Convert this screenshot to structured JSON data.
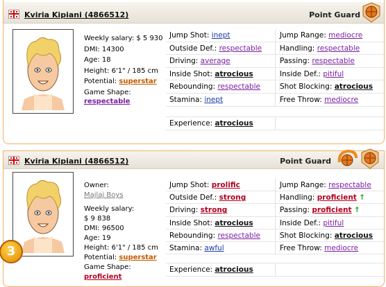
{
  "cards": [
    {
      "name": "Kviria Kipiani (4866512)",
      "position": "Point Guard",
      "info": {
        "salary": "Weekly salary: $ 5 930",
        "dmi": "DMI: 14300",
        "age": "Age: 18",
        "height": "Height: 6'1\" / 185 cm",
        "potential_label": "Potential:",
        "potential_value": "superstar",
        "shape_label": "Game Shape:",
        "shape_value": "respectable"
      },
      "skills": [
        {
          "label": "Jump Shot:",
          "value": "inept",
          "label2": "Jump Range:",
          "value2": "mediocre"
        },
        {
          "label": "Outside Def.:",
          "value": "respectable",
          "label2": "Handling:",
          "value2": "respectable"
        },
        {
          "label": "Driving:",
          "value": "average",
          "label2": "Passing:",
          "value2": "respectable"
        },
        {
          "label": "Inside Shot:",
          "value": "atrocious",
          "label2": "Inside Def.:",
          "value2": "pitiful"
        },
        {
          "label": "Rebounding:",
          "value": "respectable",
          "label2": "Shot Blocking:",
          "value2": "atrocious"
        },
        {
          "label": "Stamina:",
          "value": "inept",
          "label2": "Free Throw:",
          "value2": "mediocre"
        }
      ],
      "experience_label": "Experience:",
      "experience_value": "atrocious"
    },
    {
      "name": "Kviria Kipiani (4866512)",
      "position": "Point Guard",
      "info": {
        "owner_label": "Owner:",
        "owner_value": "Majlaj Boys",
        "salary_label": "Weekly salary:",
        "salary_value": "$ 9 838",
        "dmi": "DMI: 96500",
        "age": "Age: 19",
        "height": "Height: 6'1\" / 185 cm",
        "potential_label": "Potential:",
        "potential_value": "superstar",
        "shape_label": "Game Shape:",
        "shape_value": "proficient"
      },
      "skills": [
        {
          "label": "Jump Shot:",
          "value": "prolific",
          "label2": "Jump Range:",
          "value2": "respectable"
        },
        {
          "label": "Outside Def.:",
          "value": "strong",
          "label2": "Handling:",
          "value2": "proficient",
          "arrow2": "↑"
        },
        {
          "label": "Driving:",
          "value": "strong",
          "label2": "Passing:",
          "value2": "proficient",
          "arrow2": "↑"
        },
        {
          "label": "Inside Shot:",
          "value": "atrocious",
          "label2": "Inside Def.:",
          "value2": "pitiful"
        },
        {
          "label": "Rebounding:",
          "value": "respectable",
          "label2": "Shot Blocking:",
          "value2": "atrocious"
        },
        {
          "label": "Stamina:",
          "value": "awful",
          "label2": "Free Throw:",
          "value2": "mediocre"
        }
      ],
      "experience_label": "Experience:",
      "experience_value": "atrocious",
      "rank": "3"
    }
  ]
}
